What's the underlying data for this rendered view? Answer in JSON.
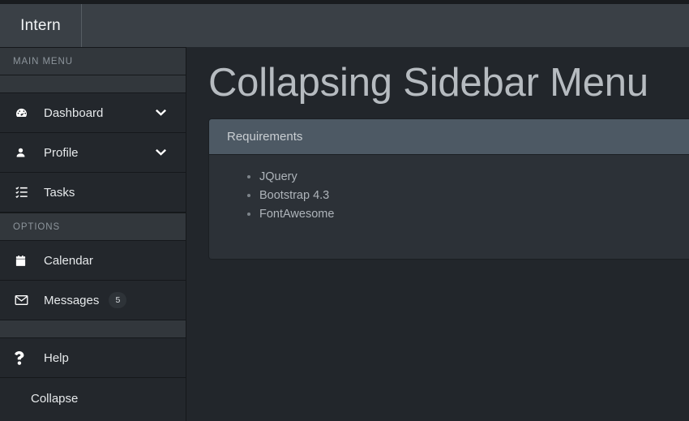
{
  "navbar": {
    "brand": "Intern"
  },
  "sidebar": {
    "sections": [
      {
        "kind": "section",
        "label": "MAIN MENU",
        "name": "sidebar-section-main-menu"
      },
      {
        "kind": "gap",
        "label": "",
        "name": "sidebar-gap-top"
      },
      {
        "kind": "item",
        "label": "Dashboard",
        "icon": "tachometer-icon",
        "chevron": "chevron-down-icon",
        "name": "sidebar-item-dashboard"
      },
      {
        "kind": "item",
        "label": "Profile",
        "icon": "user-icon",
        "chevron": "chevron-down-icon",
        "name": "sidebar-item-profile"
      },
      {
        "kind": "item",
        "label": "Tasks",
        "icon": "tasks-list-icon",
        "name": "sidebar-item-tasks"
      },
      {
        "kind": "section",
        "label": "OPTIONS",
        "name": "sidebar-section-options"
      },
      {
        "kind": "item",
        "label": "Calendar",
        "icon": "calendar-icon",
        "name": "sidebar-item-calendar"
      },
      {
        "kind": "item",
        "label": "Messages",
        "icon": "envelope-icon",
        "badge": "5",
        "name": "sidebar-item-messages"
      },
      {
        "kind": "gap",
        "label": "",
        "name": "sidebar-gap-bottom"
      },
      {
        "kind": "item",
        "label": "Help",
        "icon": "question-mark-icon",
        "name": "sidebar-item-help"
      },
      {
        "kind": "collapse",
        "label": "Collapse",
        "name": "sidebar-collapse-toggle"
      }
    ]
  },
  "main": {
    "title": "Collapsing Sidebar Menu",
    "card": {
      "header": "Requirements",
      "items": [
        "JQuery",
        "Bootstrap 4.3",
        "FontAwesome"
      ]
    }
  },
  "colors": {
    "navbar_bg": "#3a4046",
    "sidebar_bg": "#23272c",
    "section_bg": "#32373c",
    "content_bg": "#22262b",
    "card_header_bg": "#4d5964",
    "card_body_bg": "#2c3137",
    "text_primary": "#e6e9eb",
    "text_muted": "#8d959c",
    "title": "#b6bbc0"
  }
}
